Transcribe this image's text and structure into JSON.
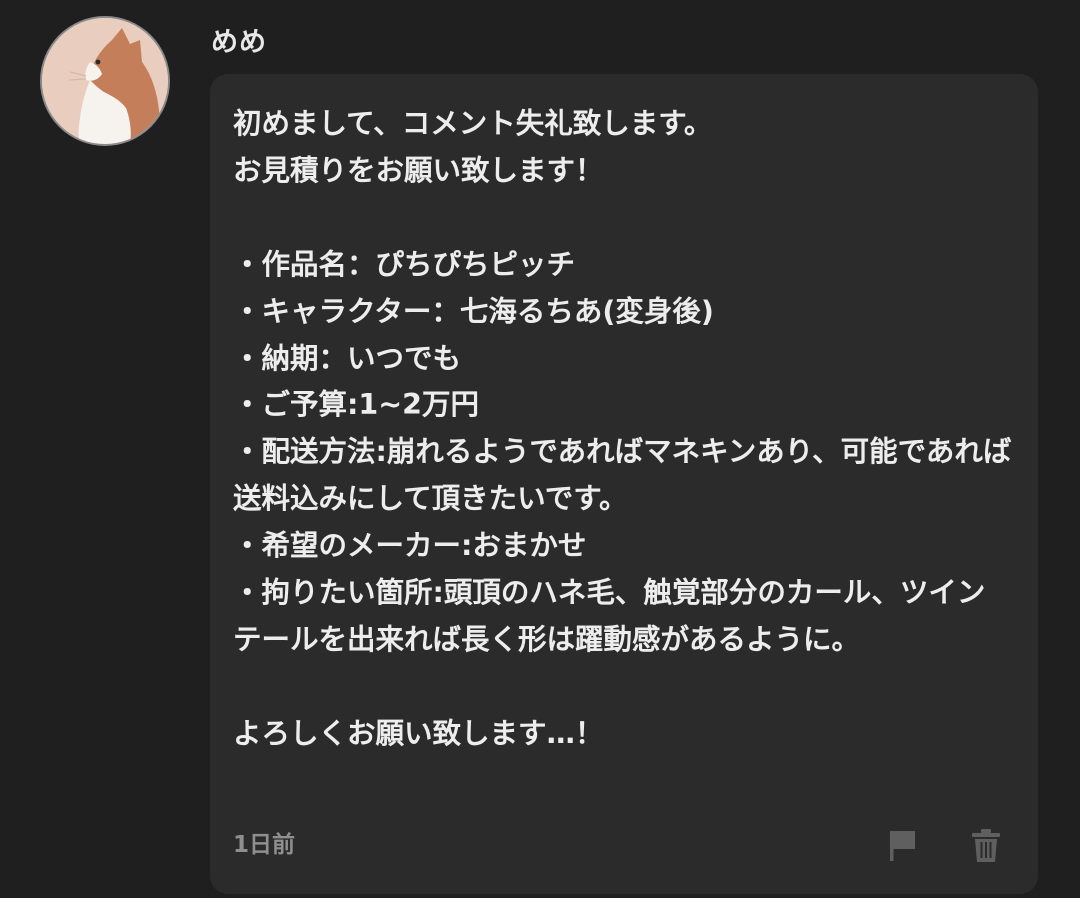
{
  "comment": {
    "author": {
      "name": "めめ",
      "avatar_icon": "cat-avatar-icon"
    },
    "body": "初めまして、コメント失礼致します。\nお見積りをお願い致します！\n\n・作品名：ぴちぴちピッチ\n・キャラクター：七海るちあ(変身後)\n・納期：いつでも\n・ご予算:1~2万円\n・配送方法:崩れるようであればマネキンあり、可能であれば送料込みにして頂きたいです。\n・希望のメーカー:おまかせ\n・拘りたい箇所:頭頂のハネ毛、触覚部分のカール、ツインテールを出来れば長く形は躍動感があるように。\n\nよろしくお願い致します…！",
    "timestamp": "1日前",
    "actions": {
      "report_icon": "flag-icon",
      "delete_icon": "trash-icon"
    }
  },
  "colors": {
    "background": "#1f1f1f",
    "bubble": "#2b2b2b",
    "text": "#ededed",
    "muted": "#8f8f8f",
    "icon": "#5f5f5f"
  }
}
